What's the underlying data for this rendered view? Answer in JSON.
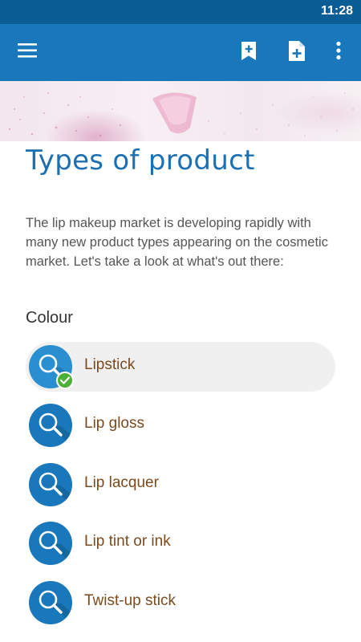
{
  "status_bar": {
    "time": "11:28"
  },
  "app_bar": {
    "icons": {
      "menu": "hamburger-menu-icon",
      "bookmark": "bookmark-add-icon",
      "new_page": "note-add-icon",
      "more": "more-vertical-icon"
    },
    "color": "#1878bb",
    "status_color": "#0b5d95"
  },
  "page": {
    "title": "Types of product",
    "intro": "The lip makeup market is developing rapidly with many new product types appearing on the cosmetic market. Let's take a look at what's out there:",
    "section_heading": "Colour"
  },
  "products": [
    {
      "label": "Lipstick",
      "selected": true,
      "completed": true
    },
    {
      "label": "Lip gloss",
      "selected": false,
      "completed": false
    },
    {
      "label": "Lip lacquer",
      "selected": false,
      "completed": false
    },
    {
      "label": "Lip tint or ink",
      "selected": false,
      "completed": false
    },
    {
      "label": "Twist-up stick",
      "selected": false,
      "completed": false
    }
  ],
  "colors": {
    "accent": "#1c6fb0",
    "label_brown": "#7a4a1e",
    "check_green": "#4caf36"
  }
}
